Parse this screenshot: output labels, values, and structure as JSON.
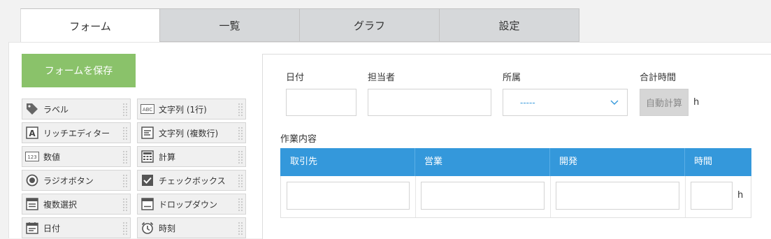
{
  "tabs": [
    {
      "label": "フォーム",
      "active": true
    },
    {
      "label": "一覧",
      "active": false
    },
    {
      "label": "グラフ",
      "active": false
    },
    {
      "label": "設定",
      "active": false
    }
  ],
  "save_button": "フォームを保存",
  "palette": [
    {
      "label": "ラベル",
      "icon": "label-tag-icon"
    },
    {
      "label": "文字列 (1行)",
      "icon": "abc-text-icon"
    },
    {
      "label": "リッチエディター",
      "icon": "rich-editor-icon"
    },
    {
      "label": "文字列 (複数行)",
      "icon": "multiline-text-icon"
    },
    {
      "label": "数値",
      "icon": "number-123-icon"
    },
    {
      "label": "計算",
      "icon": "calculator-icon"
    },
    {
      "label": "ラジオボタン",
      "icon": "radio-button-icon"
    },
    {
      "label": "チェックボックス",
      "icon": "checkbox-icon"
    },
    {
      "label": "複数選択",
      "icon": "multi-select-icon"
    },
    {
      "label": "ドロップダウン",
      "icon": "dropdown-icon"
    },
    {
      "label": "日付",
      "icon": "calendar-icon"
    },
    {
      "label": "時刻",
      "icon": "alarm-clock-icon"
    }
  ],
  "form": {
    "date_label": "日付",
    "person_label": "担当者",
    "dept_label": "所属",
    "dept_value": "-----",
    "total_label": "合計時間",
    "auto_calc": "自動計算",
    "unit_h": "h",
    "work_label": "作業内容"
  },
  "table": {
    "headers": [
      "取引先",
      "営業",
      "開発",
      "時間"
    ],
    "unit": "h"
  },
  "colors": {
    "accent": "#3498db",
    "save": "#8ac26a"
  }
}
